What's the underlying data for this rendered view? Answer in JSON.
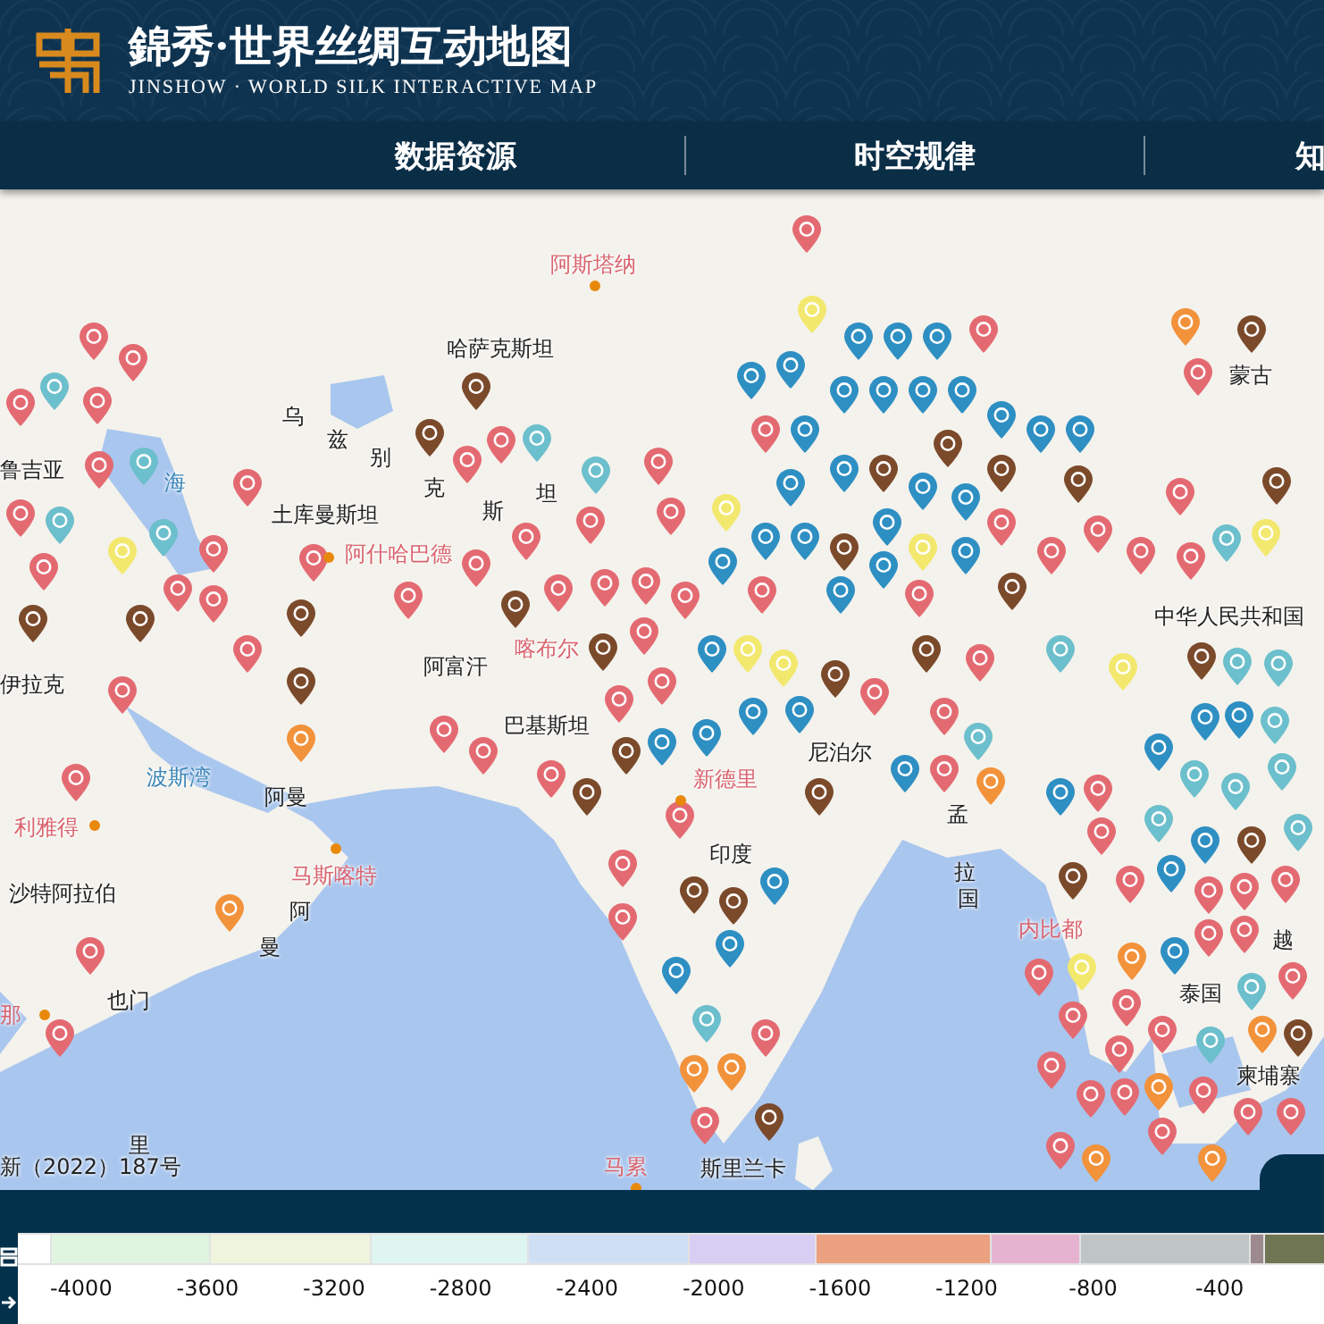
{
  "header": {
    "title": "錦秀·世界丝绸互动地图",
    "subtitle": "JINSHOW · WORLD SILK INTERACTIVE MAP"
  },
  "nav": [
    {
      "label": "数据资源"
    },
    {
      "label": "时空规律"
    },
    {
      "label": "知"
    }
  ],
  "map": {
    "labels": [
      {
        "text": "阿斯塔纳",
        "kind": "city"
      },
      {
        "text": "哈萨克斯坦",
        "kind": "country"
      },
      {
        "text": "蒙古",
        "kind": "country"
      },
      {
        "text": "乌",
        "kind": "country"
      },
      {
        "text": "兹",
        "kind": "country"
      },
      {
        "text": "别",
        "kind": "country"
      },
      {
        "text": "鲁吉亚",
        "kind": "country"
      },
      {
        "text": "海",
        "kind": "sea"
      },
      {
        "text": "克",
        "kind": "country"
      },
      {
        "text": "坦",
        "kind": "country"
      },
      {
        "text": "斯",
        "kind": "country"
      },
      {
        "text": "土库曼斯坦",
        "kind": "country"
      },
      {
        "text": "阿什哈巴德",
        "kind": "city"
      },
      {
        "text": "中华人民共和国",
        "kind": "country"
      },
      {
        "text": "喀布尔",
        "kind": "city"
      },
      {
        "text": "阿富汗",
        "kind": "country"
      },
      {
        "text": "伊拉克",
        "kind": "country"
      },
      {
        "text": "巴基斯坦",
        "kind": "country"
      },
      {
        "text": "尼泊尔",
        "kind": "country"
      },
      {
        "text": "新德里",
        "kind": "city"
      },
      {
        "text": "波斯湾",
        "kind": "sea"
      },
      {
        "text": "阿曼",
        "kind": "country"
      },
      {
        "text": "孟",
        "kind": "country"
      },
      {
        "text": "利雅得",
        "kind": "city"
      },
      {
        "text": "印度",
        "kind": "country"
      },
      {
        "text": "马斯喀特",
        "kind": "city"
      },
      {
        "text": "拉",
        "kind": "country"
      },
      {
        "text": "沙特阿拉伯",
        "kind": "country"
      },
      {
        "text": "国",
        "kind": "country"
      },
      {
        "text": "阿",
        "kind": "country"
      },
      {
        "text": "内比都",
        "kind": "city"
      },
      {
        "text": "越",
        "kind": "country"
      },
      {
        "text": "曼",
        "kind": "country"
      },
      {
        "text": "泰国",
        "kind": "country"
      },
      {
        "text": "也门",
        "kind": "country"
      },
      {
        "text": "那",
        "kind": "city"
      },
      {
        "text": "柬埔寨",
        "kind": "country"
      },
      {
        "text": "里",
        "kind": "country"
      },
      {
        "text": "新（2022）187号",
        "kind": "credit"
      },
      {
        "text": "马累",
        "kind": "city"
      },
      {
        "text": "斯里兰卡",
        "kind": "country"
      }
    ],
    "markers": [
      {
        "color": "#e46a72"
      },
      {
        "color": "#2e8fc3"
      },
      {
        "color": "#6cbfcc"
      },
      {
        "color": "#7b4a2b"
      },
      {
        "color": "#f3e86e"
      },
      {
        "color": "#f2923b"
      },
      {
        "color": "#e46a72"
      },
      {
        "color": "#2e8fc3"
      },
      {
        "color": "#6cbfcc"
      },
      {
        "color": "#7b4a2b"
      },
      {
        "color": "#f3e86e"
      },
      {
        "color": "#f2923b"
      },
      {
        "color": "#e46a72"
      },
      {
        "color": "#2e8fc3"
      },
      {
        "color": "#6cbfcc"
      },
      {
        "color": "#7b4a2b"
      },
      {
        "color": "#f3e86e"
      },
      {
        "color": "#f2923b"
      },
      {
        "color": "#e46a72"
      },
      {
        "color": "#2e8fc3"
      },
      {
        "color": "#6cbfcc"
      },
      {
        "color": "#7b4a2b"
      },
      {
        "color": "#f3e86e"
      },
      {
        "color": "#f2923b"
      },
      {
        "color": "#e46a72"
      },
      {
        "color": "#2e8fc3"
      },
      {
        "color": "#6cbfcc"
      },
      {
        "color": "#7b4a2b"
      },
      {
        "color": "#f3e86e"
      },
      {
        "color": "#f2923b"
      },
      {
        "color": "#e46a72"
      },
      {
        "color": "#2e8fc3"
      },
      {
        "color": "#6cbfcc"
      },
      {
        "color": "#7b4a2b"
      },
      {
        "color": "#f3e86e"
      },
      {
        "color": "#f2923b"
      },
      {
        "color": "#e46a72"
      },
      {
        "color": "#2e8fc3"
      },
      {
        "color": "#6cbfcc"
      },
      {
        "color": "#7b4a2b"
      },
      {
        "color": "#f3e86e"
      },
      {
        "color": "#f2923b"
      },
      {
        "color": "#e46a72"
      },
      {
        "color": "#2e8fc3"
      },
      {
        "color": "#6cbfcc"
      },
      {
        "color": "#7b4a2b"
      },
      {
        "color": "#f3e86e"
      },
      {
        "color": "#f2923b"
      },
      {
        "color": "#e46a72"
      },
      {
        "color": "#2e8fc3"
      },
      {
        "color": "#6cbfcc"
      },
      {
        "color": "#7b4a2b"
      },
      {
        "color": "#f3e86e"
      },
      {
        "color": "#f2923b"
      },
      {
        "color": "#e46a72"
      },
      {
        "color": "#2e8fc3"
      },
      {
        "color": "#6cbfcc"
      },
      {
        "color": "#7b4a2b"
      },
      {
        "color": "#f2923b"
      },
      {
        "color": "#e46a72"
      },
      {
        "color": "#2e8fc3"
      },
      {
        "color": "#6cbfcc"
      },
      {
        "color": "#7b4a2b"
      },
      {
        "color": "#f2923b"
      },
      {
        "color": "#e46a72"
      },
      {
        "color": "#2e8fc3"
      },
      {
        "color": "#6cbfcc"
      },
      {
        "color": "#7b4a2b"
      },
      {
        "color": "#e46a72"
      },
      {
        "color": "#2e8fc3"
      },
      {
        "color": "#6cbfcc"
      },
      {
        "color": "#7b4a2b"
      },
      {
        "color": "#e46a72"
      },
      {
        "color": "#2e8fc3"
      },
      {
        "color": "#6cbfcc"
      },
      {
        "color": "#7b4a2b"
      },
      {
        "color": "#e46a72"
      },
      {
        "color": "#2e8fc3"
      },
      {
        "color": "#6cbfcc"
      },
      {
        "color": "#7b4a2b"
      },
      {
        "color": "#e46a72"
      },
      {
        "color": "#2e8fc3"
      },
      {
        "color": "#6cbfcc"
      },
      {
        "color": "#7b4a2b"
      },
      {
        "color": "#e46a72"
      },
      {
        "color": "#2e8fc3"
      },
      {
        "color": "#6cbfcc"
      },
      {
        "color": "#7b4a2b"
      },
      {
        "color": "#e46a72"
      },
      {
        "color": "#2e8fc3"
      },
      {
        "color": "#6cbfcc"
      },
      {
        "color": "#7b4a2b"
      },
      {
        "color": "#e46a72"
      },
      {
        "color": "#2e8fc3"
      },
      {
        "color": "#6cbfcc"
      },
      {
        "color": "#7b4a2b"
      },
      {
        "color": "#e46a72"
      },
      {
        "color": "#2e8fc3"
      },
      {
        "color": "#6cbfcc"
      },
      {
        "color": "#7b4a2b"
      },
      {
        "color": "#e46a72"
      },
      {
        "color": "#2e8fc3"
      },
      {
        "color": "#7b4a2b"
      },
      {
        "color": "#e46a72"
      },
      {
        "color": "#2e8fc3"
      },
      {
        "color": "#7b4a2b"
      },
      {
        "color": "#e46a72"
      },
      {
        "color": "#2e8fc3"
      },
      {
        "color": "#7b4a2b"
      },
      {
        "color": "#e46a72"
      },
      {
        "color": "#2e8fc3"
      },
      {
        "color": "#7b4a2b"
      },
      {
        "color": "#e46a72"
      },
      {
        "color": "#2e8fc3"
      },
      {
        "color": "#7b4a2b"
      },
      {
        "color": "#e46a72"
      },
      {
        "color": "#2e8fc3"
      },
      {
        "color": "#7b4a2b"
      },
      {
        "color": "#e46a72"
      },
      {
        "color": "#2e8fc3"
      },
      {
        "color": "#7b4a2b"
      },
      {
        "color": "#e46a72"
      },
      {
        "color": "#2e8fc3"
      },
      {
        "color": "#7b4a2b"
      },
      {
        "color": "#e46a72"
      },
      {
        "color": "#2e8fc3"
      },
      {
        "color": "#e46a72"
      },
      {
        "color": "#2e8fc3"
      },
      {
        "color": "#e46a72"
      },
      {
        "color": "#2e8fc3"
      },
      {
        "color": "#e46a72"
      },
      {
        "color": "#2e8fc3"
      },
      {
        "color": "#e46a72"
      },
      {
        "color": "#2e8fc3"
      },
      {
        "color": "#e46a72"
      },
      {
        "color": "#2e8fc3"
      },
      {
        "color": "#e46a72"
      },
      {
        "color": "#2e8fc3"
      },
      {
        "color": "#e46a72"
      },
      {
        "color": "#2e8fc3"
      },
      {
        "color": "#e46a72"
      },
      {
        "color": "#2e8fc3"
      },
      {
        "color": "#e46a72"
      },
      {
        "color": "#2e8fc3"
      },
      {
        "color": "#e46a72"
      },
      {
        "color": "#2e8fc3"
      },
      {
        "color": "#e46a72"
      },
      {
        "color": "#2e8fc3"
      },
      {
        "color": "#e46a72"
      },
      {
        "color": "#e46a72"
      },
      {
        "color": "#e46a72"
      },
      {
        "color": "#e46a72"
      },
      {
        "color": "#e46a72"
      },
      {
        "color": "#e46a72"
      },
      {
        "color": "#e46a72"
      },
      {
        "color": "#e46a72"
      },
      {
        "color": "#e46a72"
      },
      {
        "color": "#e46a72"
      },
      {
        "color": "#e46a72"
      },
      {
        "color": "#e46a72"
      },
      {
        "color": "#e46a72"
      },
      {
        "color": "#e46a72"
      },
      {
        "color": "#e46a72"
      },
      {
        "color": "#e46a72"
      },
      {
        "color": "#e46a72"
      },
      {
        "color": "#e46a72"
      },
      {
        "color": "#e46a72"
      },
      {
        "color": "#e46a72"
      },
      {
        "color": "#e46a72"
      },
      {
        "color": "#e46a72"
      },
      {
        "color": "#e46a72"
      },
      {
        "color": "#e46a72"
      },
      {
        "color": "#e46a72"
      },
      {
        "color": "#e46a72"
      },
      {
        "color": "#e46a72"
      },
      {
        "color": "#e46a72"
      },
      {
        "color": "#e46a72"
      },
      {
        "color": "#e46a72"
      },
      {
        "color": "#e46a72"
      },
      {
        "color": "#e46a72"
      },
      {
        "color": "#e46a72"
      },
      {
        "color": "#e46a72"
      },
      {
        "color": "#e46a72"
      },
      {
        "color": "#e46a72"
      },
      {
        "color": "#e46a72"
      },
      {
        "color": "#e46a72"
      }
    ]
  },
  "legend": {
    "swatches": [
      {
        "color": "#ffffff"
      },
      {
        "color": "#e0f5e0"
      },
      {
        "color": "#eef5dc"
      },
      {
        "color": "#dff5f0"
      },
      {
        "color": "#cfe0f5"
      },
      {
        "color": "#d8cdf2"
      },
      {
        "color": "#eba07f"
      },
      {
        "color": "#e5b3cf"
      },
      {
        "color": "#bfc4c4"
      },
      {
        "color": "#9c8a8f"
      },
      {
        "color": "#6f7552"
      }
    ],
    "ticks": [
      "-4000",
      "-3600",
      "-3200",
      "-2800",
      "-2400",
      "-2000",
      "-1600",
      "-1200",
      "-800",
      "-400"
    ]
  }
}
